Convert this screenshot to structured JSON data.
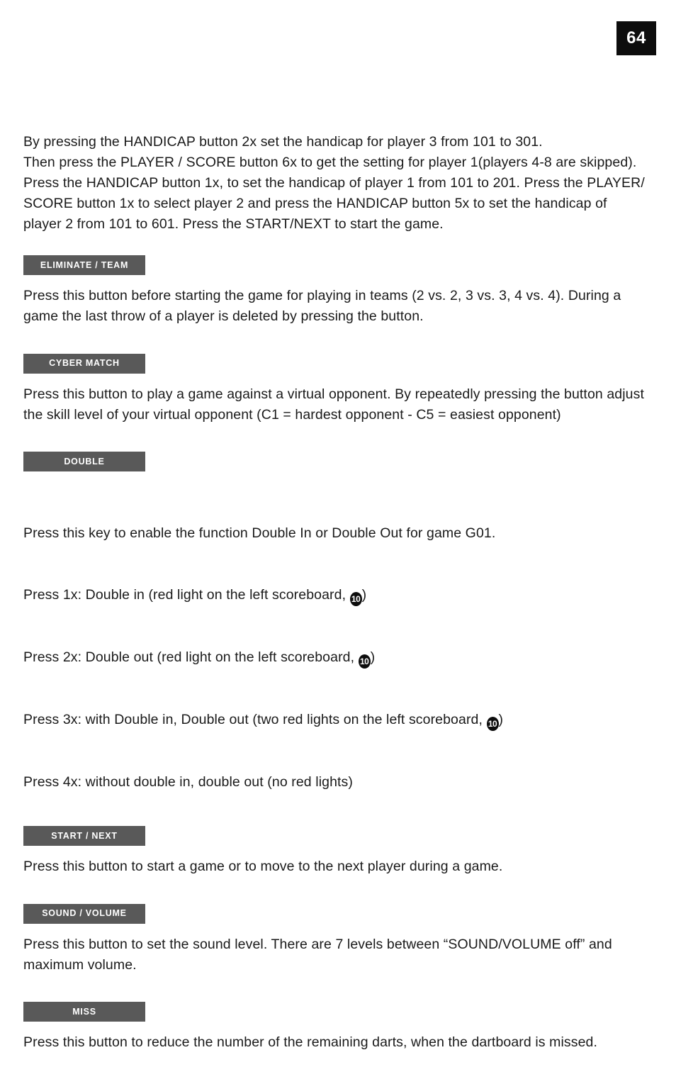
{
  "page": {
    "number": "64"
  },
  "intro": {
    "text": "By pressing the HANDICAP button 2x set the handicap for player 3 from 101 to 301.\nThen press the PLAYER / SCORE button 6x to get the setting for player 1(players 4-8 are skipped).\nPress the HANDICAP button 1x, to set the handicap of player 1 from 101 to 201. Press the PLAYER/\nSCORE button 1x to select player 2 and press the HANDICAP button 5x to set the handicap of\nplayer 2 from 101 to 601. Press the START/NEXT to start the game."
  },
  "sections": [
    {
      "label": "ELIMINATE / TEAM",
      "body": "Press this button before starting the game for playing in teams (2 vs. 2, 3 vs. 3, 4 vs. 4). During a\ngame the last throw of a player is deleted by pressing the button."
    },
    {
      "label": "CYBER MATCH",
      "body": "Press this button to play a game against a virtual opponent. By repeatedly pressing the button adjust\nthe skill level of your virtual opponent (C1 = hardest opponent - C5 = easiest opponent)"
    },
    {
      "label": "DOUBLE",
      "lines": [
        {
          "pre": "Press this key to enable the function Double In or Double Out for game G01.",
          "badge": "",
          "post": ""
        },
        {
          "pre": "Press 1x: Double in (red light on the left scoreboard, ",
          "badge": "10",
          "post": ")"
        },
        {
          "pre": "Press 2x: Double out (red light on the left scoreboard, ",
          "badge": "10",
          "post": ")"
        },
        {
          "pre": "Press 3x: with Double in, Double out (two red lights on the left scoreboard, ",
          "badge": "10",
          "post": ")"
        },
        {
          "pre": "Press 4x: without double in, double out (no red lights)",
          "badge": "",
          "post": ""
        }
      ]
    },
    {
      "label": "START / NEXT",
      "body": "Press this button to start a game or to move to the next player during a game."
    },
    {
      "label": "SOUND / VOLUME",
      "body": "Press this button to set the sound level. There are 7 levels between “SOUND/VOLUME off” and\nmaximum volume."
    },
    {
      "label": "MISS",
      "body": "Press this button to reduce the number of the remaining darts, when the dartboard is missed."
    }
  ],
  "colors": {
    "label_box": "#595959",
    "page_badge": "#0d0d0d",
    "text": "#1a1a1a"
  }
}
